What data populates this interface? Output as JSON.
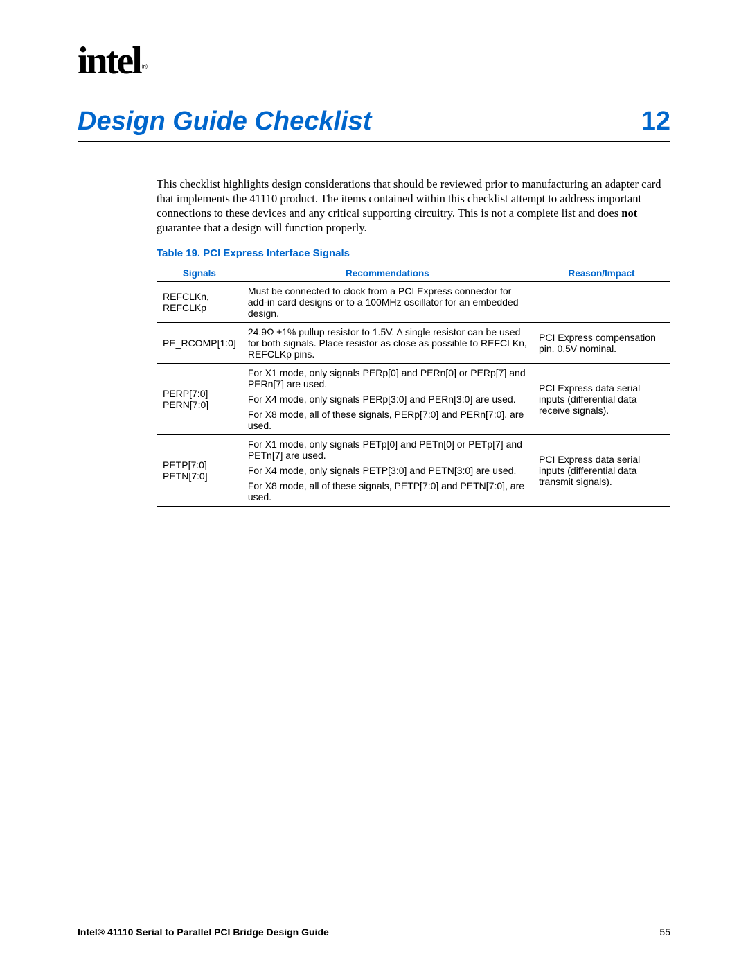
{
  "logo": {
    "text": "intel",
    "registered": "®"
  },
  "chapter": {
    "title": "Design Guide Checklist",
    "number": "12"
  },
  "intro": {
    "text": "This checklist highlights design considerations that should be reviewed prior to manufacturing an adapter card that implements the 41110 product. The items contained within this checklist attempt to address important connections to these devices and any critical supporting circuitry. This is not a complete list and does ",
    "bold": "not",
    "text2": " guarantee that a design will function properly."
  },
  "table": {
    "caption": "Table 19. PCI Express Interface Signals",
    "headers": [
      "Signals",
      "Recommendations",
      "Reason/Impact"
    ],
    "rows": [
      {
        "signals": [
          "REFCLKn,",
          "REFCLKp"
        ],
        "recs": [
          "Must be connected to clock from a PCI Express connector for add-in card designs or to a 100MHz oscillator for an embedded design."
        ],
        "reason": ""
      },
      {
        "signals": [
          "PE_RCOMP[1:0]"
        ],
        "recs": [
          "24.9Ω ±1% pullup resistor to 1.5V. A single resistor can be used for both signals. Place resistor as close as possible to REFCLKn, REFCLKp pins."
        ],
        "reason": "PCI Express compensation pin. 0.5V nominal."
      },
      {
        "signals": [
          "PERP[7:0]",
          "PERN[7:0]"
        ],
        "recs": [
          "For X1 mode, only signals PERp[0] and PERn[0] or PERp[7] and PERn[7] are used.",
          "For X4 mode, only signals PERp[3:0] and PERn[3:0] are used.",
          "For X8 mode, all of these signals, PERp[7:0] and PERn[7:0], are used."
        ],
        "reason": "PCI Express data serial inputs (differential data receive signals)."
      },
      {
        "signals": [
          "PETP[7:0]",
          "PETN[7:0]"
        ],
        "recs": [
          "For X1 mode, only signals PETp[0] and PETn[0] or PETp[7] and PETn[7] are used.",
          "For X4 mode, only signals PETP[3:0] and PETN[3:0] are used.",
          "For X8 mode, all of these signals, PETP[7:0] and PETN[7:0], are used."
        ],
        "reason": "PCI Express data serial inputs (differential data transmit signals)."
      }
    ]
  },
  "footer": {
    "title": "Intel® 41110 Serial to Parallel PCI Bridge Design Guide",
    "page": "55"
  }
}
